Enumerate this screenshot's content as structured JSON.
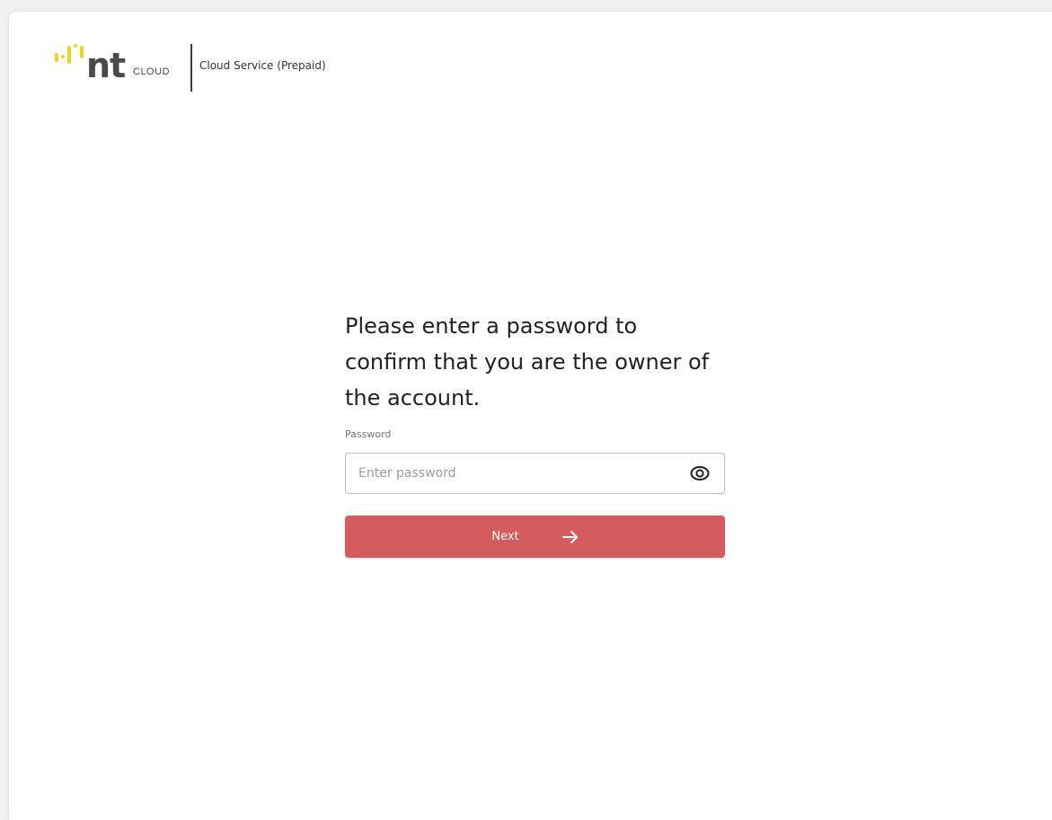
{
  "header": {
    "logo_text": "nt",
    "logo_subtext": "CLOUD",
    "subtitle": "Cloud Service (Prepaid)"
  },
  "form": {
    "title": "Please enter a password to confirm that you are the owner of the account.",
    "password_label": "Password",
    "password_placeholder": "Enter password",
    "password_value": "",
    "next_label": "Next"
  },
  "icons": {
    "toggle_visibility": "eye-icon",
    "next_arrow": "arrow-right-icon"
  },
  "colors": {
    "accent": "#d45c5c",
    "logo_yellow": "#f2d21b",
    "logo_gray": "#4a4a4a"
  }
}
